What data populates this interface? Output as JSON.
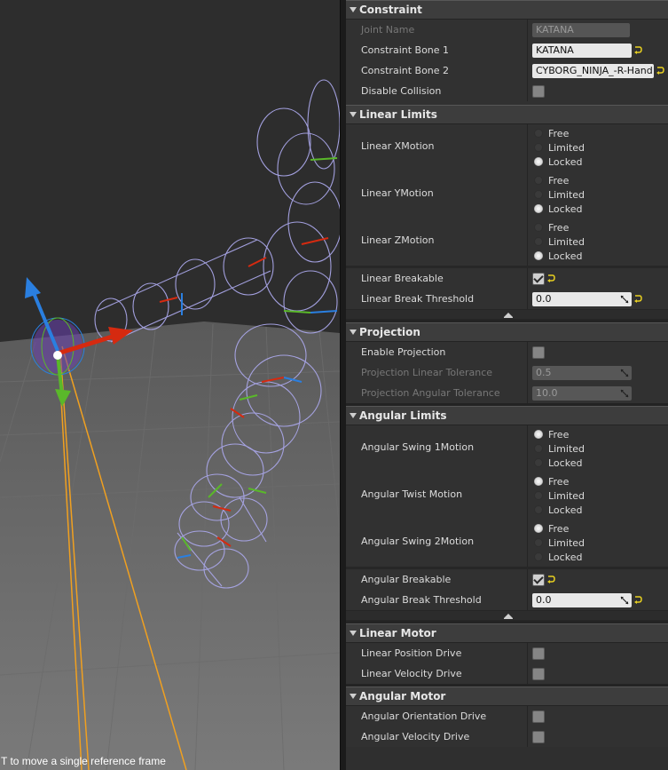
{
  "viewport": {
    "hint": "T to move a single reference frame"
  },
  "panel": {
    "constraint": {
      "header": "Constraint",
      "joint_name_label": "Joint Name",
      "joint_name_value": "KATANA",
      "bone1_label": "Constraint Bone 1",
      "bone1_value": "KATANA",
      "bone2_label": "Constraint Bone 2",
      "bone2_value": "CYBORG_NINJA_-R-Hand",
      "disable_collision_label": "Disable Collision"
    },
    "linear_limits": {
      "header": "Linear Limits",
      "x_label": "Linear XMotion",
      "y_label": "Linear YMotion",
      "z_label": "Linear ZMotion",
      "breakable_label": "Linear Breakable",
      "threshold_label": "Linear Break Threshold",
      "threshold_value": "0.0"
    },
    "projection": {
      "header": "Projection",
      "enable_label": "Enable Projection",
      "linear_tol_label": "Projection Linear Tolerance",
      "linear_tol_value": "0.5",
      "angular_tol_label": "Projection Angular Tolerance",
      "angular_tol_value": "10.0"
    },
    "angular_limits": {
      "header": "Angular Limits",
      "swing1_label": "Angular Swing 1Motion",
      "twist_label": "Angular Twist Motion",
      "swing2_label": "Angular Swing 2Motion",
      "breakable_label": "Angular Breakable",
      "threshold_label": "Angular Break Threshold",
      "threshold_value": "0.0"
    },
    "linear_motor": {
      "header": "Linear Motor",
      "position_label": "Linear Position Drive",
      "velocity_label": "Linear Velocity Drive"
    },
    "angular_motor": {
      "header": "Angular Motor",
      "orientation_label": "Angular Orientation Drive",
      "velocity_label": "Angular Velocity Drive"
    }
  },
  "motion_options": {
    "free": "Free",
    "limited": "Limited",
    "locked": "Locked"
  },
  "selections": {
    "linear_x": "Locked",
    "linear_y": "Locked",
    "linear_z": "Locked",
    "angular_swing1": "Free",
    "angular_twist": "Free",
    "angular_swing2": "Free",
    "linear_breakable": true,
    "angular_breakable": true,
    "disable_collision": false,
    "enable_projection": false
  },
  "colors": {
    "reset_arrow": "#e8d020",
    "wireframe": "#a9a6e8",
    "gizmo_x": "#d52a10",
    "gizmo_y": "#5ab82a",
    "gizmo_z": "#2a7fe0",
    "rope": "#f0a020"
  }
}
